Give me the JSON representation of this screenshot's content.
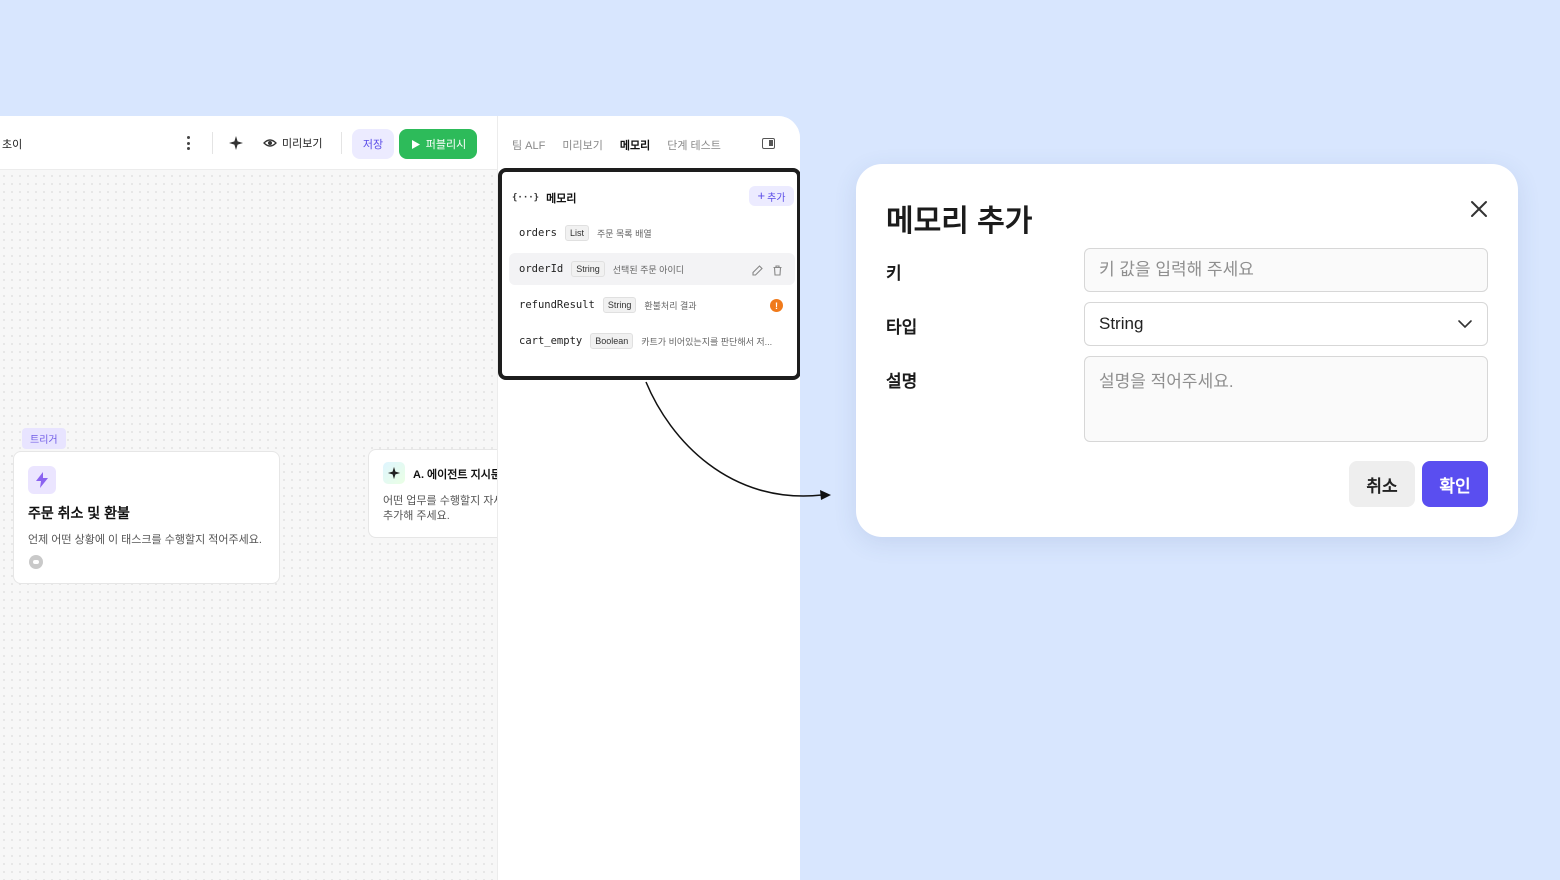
{
  "toolbar": {
    "title": "초이",
    "preview_label": "미리보기",
    "save_label": "저장",
    "publish_label": "퍼블리시"
  },
  "canvas": {
    "trigger_tag": "트리거",
    "trigger_card": {
      "title": "주문 취소 및 환불",
      "description": "언제 어떤 상황에 이 태스크를 수행할지 적어주세요."
    },
    "agent_card": {
      "title": "A. 에이전트 지시문",
      "description": "어떤 업무를 수행할지 자세히 추가해 주세요."
    }
  },
  "panel": {
    "tabs": [
      {
        "label": "팀 ALF"
      },
      {
        "label": "미리보기"
      },
      {
        "label": "메모리"
      },
      {
        "label": "단계 테스트"
      }
    ],
    "active_tab": "메모리",
    "memory": {
      "header_icon": "{···}",
      "header": "메모리",
      "add_label": "추가",
      "items": [
        {
          "key": "orders",
          "type": "List",
          "description": "주문 목록 배열"
        },
        {
          "key": "orderId",
          "type": "String",
          "description": "선택된 주문 아이디"
        },
        {
          "key": "refundResult",
          "type": "String",
          "description": "환불처리 결과"
        },
        {
          "key": "cart_empty",
          "type": "Boolean",
          "description": "카트가 비어있는지를 판단해서 저..."
        }
      ]
    }
  },
  "modal": {
    "title": "메모리 추가",
    "key_label": "키",
    "key_placeholder": "키 값을 입력해 주세요",
    "type_label": "타입",
    "type_value": "String",
    "desc_label": "설명",
    "desc_placeholder": "설명을 적어주세요.",
    "cancel_label": "취소",
    "confirm_label": "확인"
  },
  "colors": {
    "background": "#d8e6fe",
    "accent": "#5a4ef0",
    "publish": "#2dbb5a",
    "warning": "#f07a1b"
  },
  "icons": [
    "more-vertical-icon",
    "sparkle-icon",
    "eye-icon",
    "play-icon",
    "panel-toggle-icon",
    "plus-icon",
    "edit-icon",
    "trash-icon",
    "warning-icon",
    "close-icon",
    "chevron-down-icon",
    "lightning-icon",
    "chat-icon"
  ]
}
